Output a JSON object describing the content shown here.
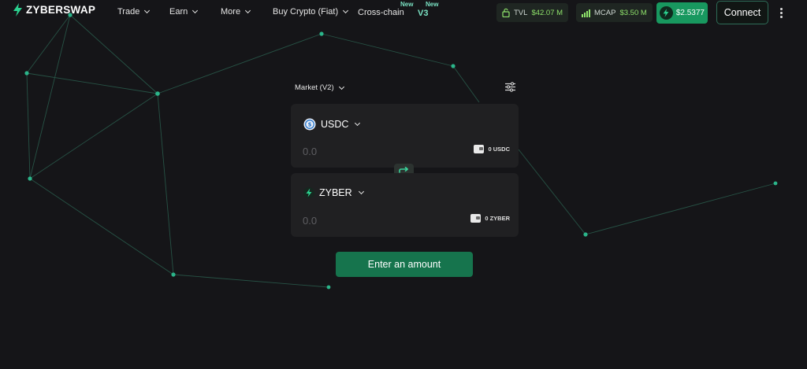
{
  "nav": {
    "logo": "ZYBERSWAP",
    "items": [
      {
        "label": "Trade"
      },
      {
        "label": "Earn"
      },
      {
        "label": "More"
      },
      {
        "label": "Buy Crypto (Fiat)"
      }
    ],
    "crosschain": {
      "label": "Cross-chain",
      "badge": "New"
    },
    "v3": {
      "label": "V3",
      "badge": "New"
    },
    "tvl": {
      "label": "TVL",
      "value": "$42.07 M",
      "icon": "lock-icon"
    },
    "mcap": {
      "label": "MCAP",
      "value": "$3.50 M",
      "icon": "bar-chart-icon"
    },
    "price": "$2.5377",
    "connect": "Connect"
  },
  "swap": {
    "mode": "Market (V2)",
    "from": {
      "token": "USDC",
      "amount_placeholder": "0.0",
      "balance": "0 USDC"
    },
    "to": {
      "token": "ZYBER",
      "amount_placeholder": "0.0",
      "balance": "0 ZYBER"
    },
    "action": "Enter an amount"
  },
  "colors": {
    "accent": "#18985f",
    "background": "#151518",
    "panel": "#202022",
    "network": "#2bb58a"
  }
}
